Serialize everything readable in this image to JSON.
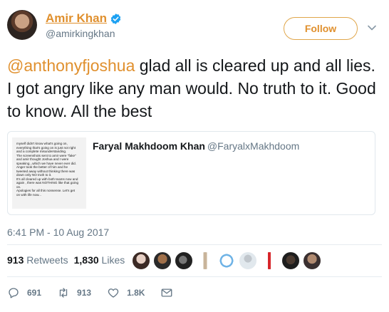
{
  "tweet": {
    "author": {
      "display_name": "Amir Khan",
      "handle": "@amirkingkhan",
      "verified_icon": "verified-badge-icon"
    },
    "follow_label": "Follow",
    "text": {
      "mention": "@anthonyfjoshua",
      "body": " glad all is cleared up and all lies. I got angry like any man would. No truth to it. Good to know. All the best"
    },
    "quoted": {
      "display_name": "Faryal Makhdoom Khan",
      "handle": "@FaryalxMakhdoom",
      "thumbnail_text": "myself didn't know what's going on,\neverything that's going on is just not right\nand a complete misunderstanding.\nThe screenshots sent to amir were \"fake\"\nand amir thought Joshua and I were\nspeaking...which we have never ever did.\nAnger took the better of him and he\ntweeted away without thinking there was\ndown only NO truth to it.\nIt's all cleared up with both teams now and\nagain , there was NOTHING like that going\non.\nApologies for all this nonsense. Let's get\non with life now..."
    },
    "timestamp": "6:41 PM - 10 Aug 2017",
    "stats": {
      "retweets_count": "913",
      "retweets_label": "Retweets",
      "likes_count": "1,830",
      "likes_label": "Likes"
    },
    "actions": {
      "reply_count": "691",
      "retweet_count": "913",
      "like_count": "1.8K"
    },
    "colors": {
      "accent": "#e0902e",
      "text": "#14171a",
      "muted": "#657786"
    }
  }
}
